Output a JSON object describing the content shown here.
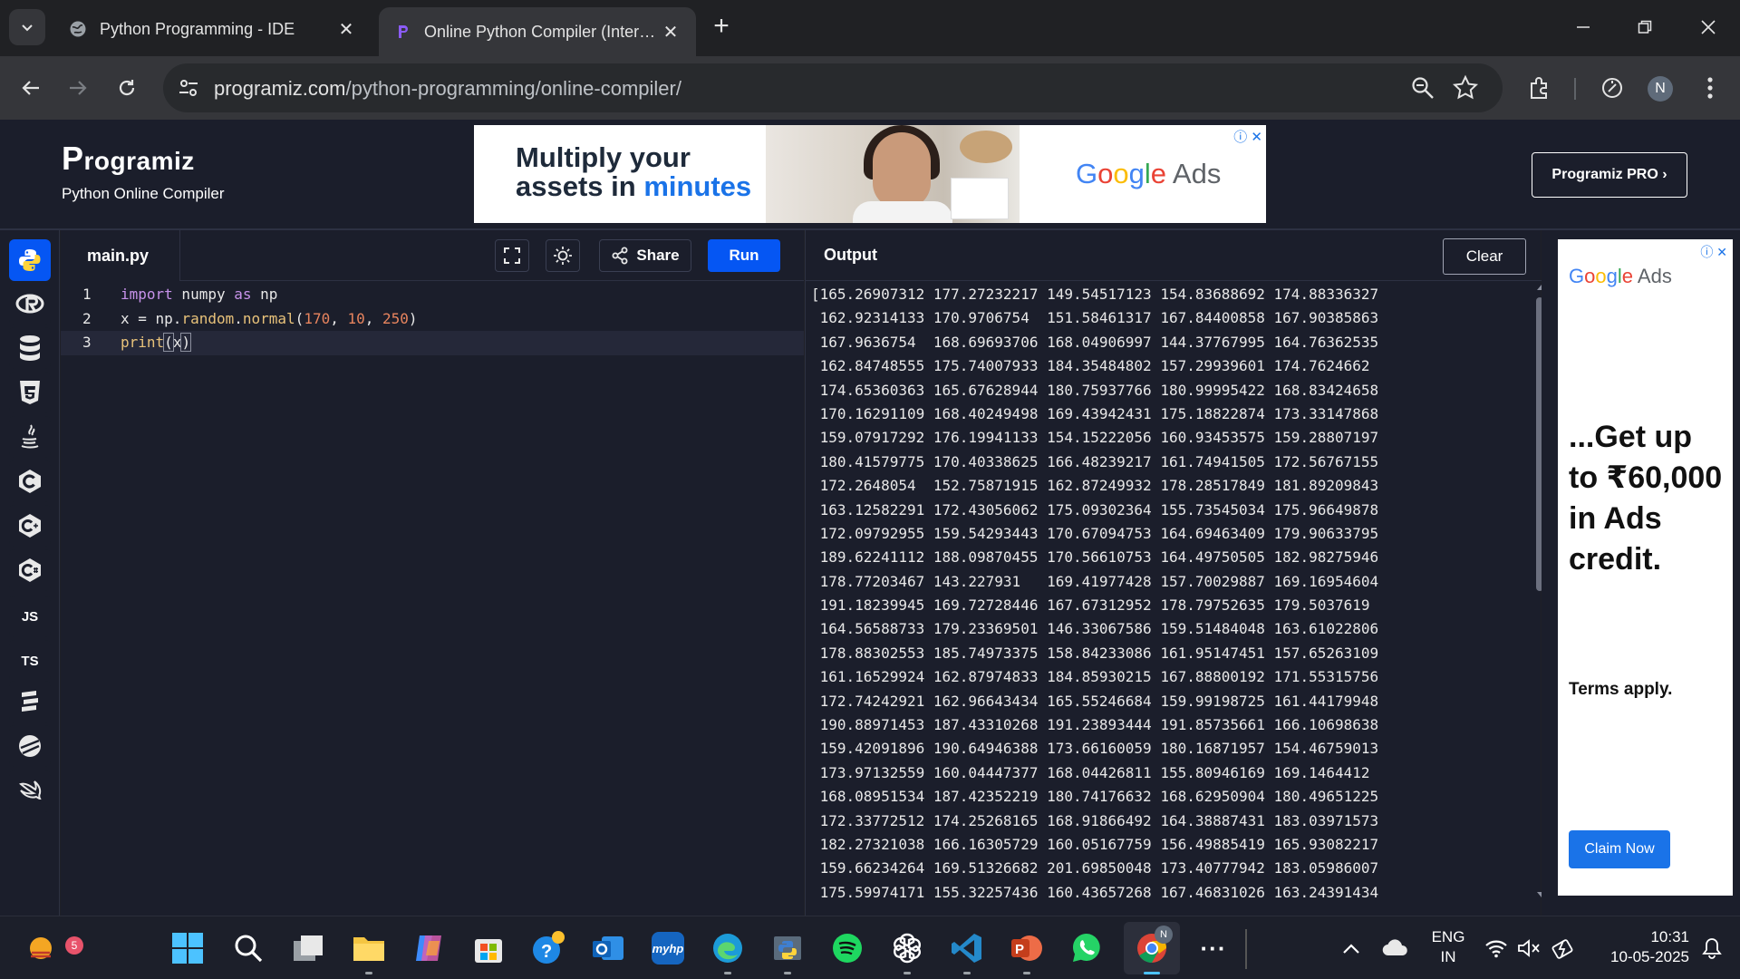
{
  "browser": {
    "tabs": [
      {
        "title": "Python Programming - IDE",
        "active": false
      },
      {
        "title": "Online Python Compiler (Interpreter)",
        "active": true
      }
    ],
    "new_tab_label": "+",
    "url_host": "programiz.com",
    "url_path": "/python-programming/online-compiler/",
    "avatar_initial": "N"
  },
  "site": {
    "logo": "Programiz",
    "logo_mark": "P",
    "logo_rest": "rogramiz",
    "subtitle": "Python Online Compiler",
    "pro_button": "Programiz PRO ›"
  },
  "banner_ad": {
    "line1": "Multiply your",
    "line2_prefix": "assets in ",
    "line2_accent": "minutes",
    "brand": "Google Ads",
    "brand_colors": [
      "#4285F4",
      "#EA4335",
      "#FBBC05",
      "#4285F4",
      "#34A853",
      "#EA4335"
    ]
  },
  "languages": [
    {
      "name": "python-icon",
      "label": "",
      "active": true
    },
    {
      "name": "r-icon",
      "label": "R",
      "active": false
    },
    {
      "name": "sql-icon",
      "label": "",
      "active": false
    },
    {
      "name": "html-icon",
      "label": "5",
      "active": false
    },
    {
      "name": "java-icon",
      "label": "",
      "active": false
    },
    {
      "name": "c-icon",
      "label": "C",
      "active": false
    },
    {
      "name": "cpp-icon",
      "label": "C",
      "active": false
    },
    {
      "name": "csharp-icon",
      "label": "C",
      "active": false
    },
    {
      "name": "javascript-icon",
      "label": "JS",
      "active": false
    },
    {
      "name": "typescript-icon",
      "label": "TS",
      "active": false
    },
    {
      "name": "go-icon",
      "label": "",
      "active": false
    },
    {
      "name": "php-icon",
      "label": "",
      "active": false
    },
    {
      "name": "swift-icon",
      "label": "",
      "active": false
    }
  ],
  "editor": {
    "filename": "main.py",
    "share_label": "Share",
    "run_label": "Run",
    "line_numbers": [
      "1",
      "2",
      "3"
    ]
  },
  "output": {
    "title": "Output",
    "clear_label": "Clear",
    "lines": [
      "[165.26907312 177.27232217 149.54517123 154.83688692 174.88336327",
      " 162.92314133 170.9706754  151.58461317 167.84400858 167.90385863",
      " 167.9636754  168.69693706 168.04906997 144.37767995 164.76362535",
      " 162.84748555 175.74007933 184.35484802 157.29939601 174.7624662 ",
      " 174.65360363 165.67628944 180.75937766 180.99995422 168.83424658",
      " 170.16291109 168.40249498 169.43942431 175.18822874 173.33147868",
      " 159.07917292 176.19941133 154.15222056 160.93453575 159.28807197",
      " 180.41579775 170.40338625 166.48239217 161.74941505 172.56767155",
      " 172.2648054  152.75871915 162.87249932 178.28517849 181.89209843",
      " 163.12582291 172.43056062 175.09302364 155.73545034 175.96649878",
      " 172.09792955 159.54293443 170.67094753 164.69463409 179.90633795",
      " 189.62241112 188.09870455 170.56610753 164.49750505 182.98275946",
      " 178.77203467 143.227931   169.41977428 157.70029887 169.16954604",
      " 191.18239945 169.72728446 167.67312952 178.79752635 179.5037619 ",
      " 164.56588733 179.23369501 146.33067586 159.51484048 163.61022806",
      " 178.88302553 185.74973375 158.84233086 161.95147451 157.65263109",
      " 161.16529924 162.87974833 184.85930215 167.88800192 171.55315756",
      " 172.74242921 162.96643434 165.55246684 159.99198725 161.44179948",
      " 190.88971453 187.43310268 191.23893444 191.85735661 166.10698638",
      " 159.42091896 190.64946388 173.66160059 180.16871957 154.46759013",
      " 173.97132559 160.04447377 168.04426811 155.80946169 169.1464412 ",
      " 168.08951534 187.42352219 180.74176632 168.62950904 180.49651225",
      " 172.33772512 174.25268165 168.91866492 164.38887431 183.03971573",
      " 182.27321038 166.16305729 160.05167759 156.49885419 165.93082217",
      " 159.66234264 169.51326682 201.69850048 173.40777942 183.05986007",
      " 175.59974171 155.32257436 160.43657268 167.46831026 163.24391434"
    ]
  },
  "side_ad": {
    "brand": "Google Ads",
    "headline": "...Get up to ₹60,000 in Ads credit.",
    "terms": "Terms apply.",
    "cta": "Claim Now"
  },
  "taskbar": {
    "weather_badge": "5",
    "language_line1": "ENG",
    "language_line2": "IN",
    "time": "10:31",
    "date": "10-05-2025",
    "overflow_label": "···"
  },
  "colors": {
    "accent": "#0556f3",
    "page_bg": "#1b1e2b",
    "chrome_bg": "#202124"
  }
}
